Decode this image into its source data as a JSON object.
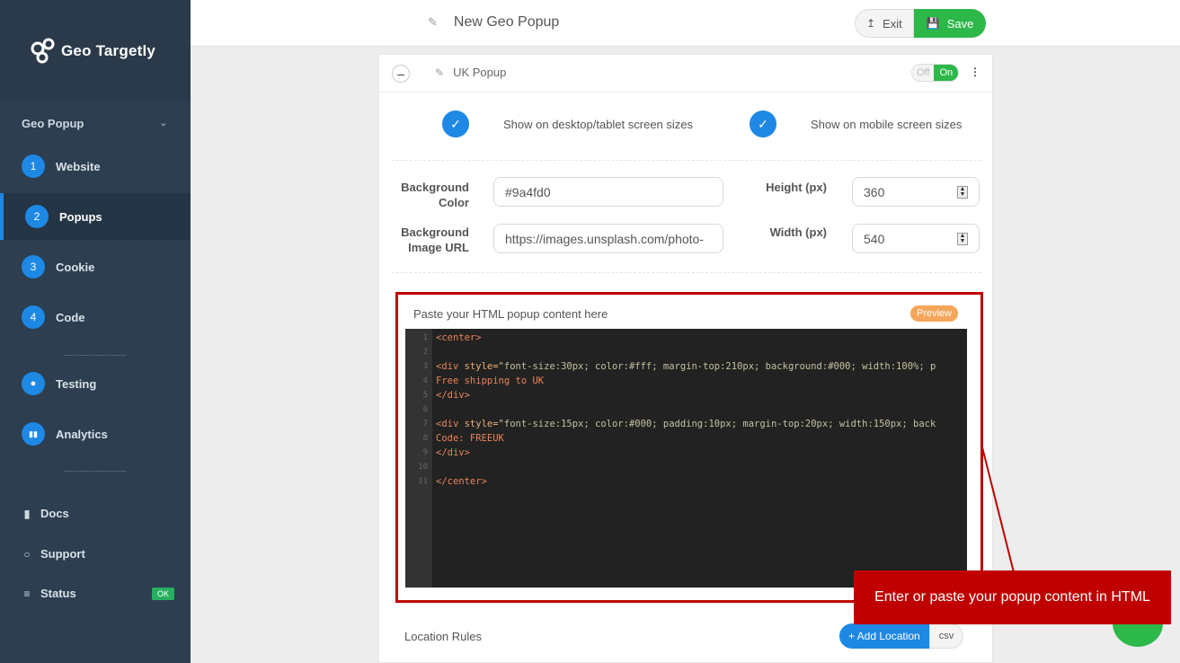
{
  "brand": {
    "name": "Geo Targetly"
  },
  "sidebar": {
    "section_title": "Geo Popup",
    "steps": [
      {
        "num": "1",
        "label": "Website"
      },
      {
        "num": "2",
        "label": "Popups"
      },
      {
        "num": "3",
        "label": "Cookie"
      },
      {
        "num": "4",
        "label": "Code"
      }
    ],
    "extra": [
      {
        "label": "Testing"
      },
      {
        "label": "Analytics"
      }
    ],
    "links": [
      {
        "label": "Docs"
      },
      {
        "label": "Support"
      },
      {
        "label": "Status"
      }
    ],
    "status_badge": "OK"
  },
  "header": {
    "title": "New Geo Popup",
    "exit_label": "Exit",
    "save_label": "Save"
  },
  "popup": {
    "name": "UK Popup",
    "toggle_off": "Off",
    "toggle_on": "On",
    "desktop_label": "Show on desktop/tablet screen sizes",
    "mobile_label": "Show on mobile screen sizes",
    "bg_color_label_1": "Background",
    "bg_color_label_2": "Color",
    "bg_color_value": "#9a4fd0",
    "bg_image_label_1": "Background",
    "bg_image_label_2": "Image URL",
    "bg_image_value": "https://images.unsplash.com/photo-",
    "height_label": "Height (px)",
    "height_value": "360",
    "width_label": "Width (px)",
    "width_value": "540",
    "html_label": "Paste your HTML popup content here",
    "preview_label": "Preview",
    "code_lines": [
      "<center>",
      "",
      "<div style=\"font-size:30px; color:#fff; margin-top:210px; background:#000; width:100%; p",
      "Free shipping to UK",
      "</div>",
      "",
      "<div style=\"font-size:15px; color:#000; padding:10px; margin-top:20px; width:150px; back",
      "Code: FREEUK",
      "</div>",
      "",
      "</center>"
    ],
    "line_numbers": [
      "1",
      "2",
      "3",
      "4",
      "5",
      "6",
      "7",
      "8",
      "9",
      "10",
      "11"
    ],
    "location_rules_label": "Location Rules",
    "add_location_label": "+ Add Location",
    "csv_label": "csv"
  },
  "callout": {
    "text": "Enter or paste your popup content in HTML"
  },
  "colors": {
    "accent": "#1e88e5",
    "save": "#2db84a",
    "callout": "#c00000",
    "sidebar": "#2c3e50"
  }
}
